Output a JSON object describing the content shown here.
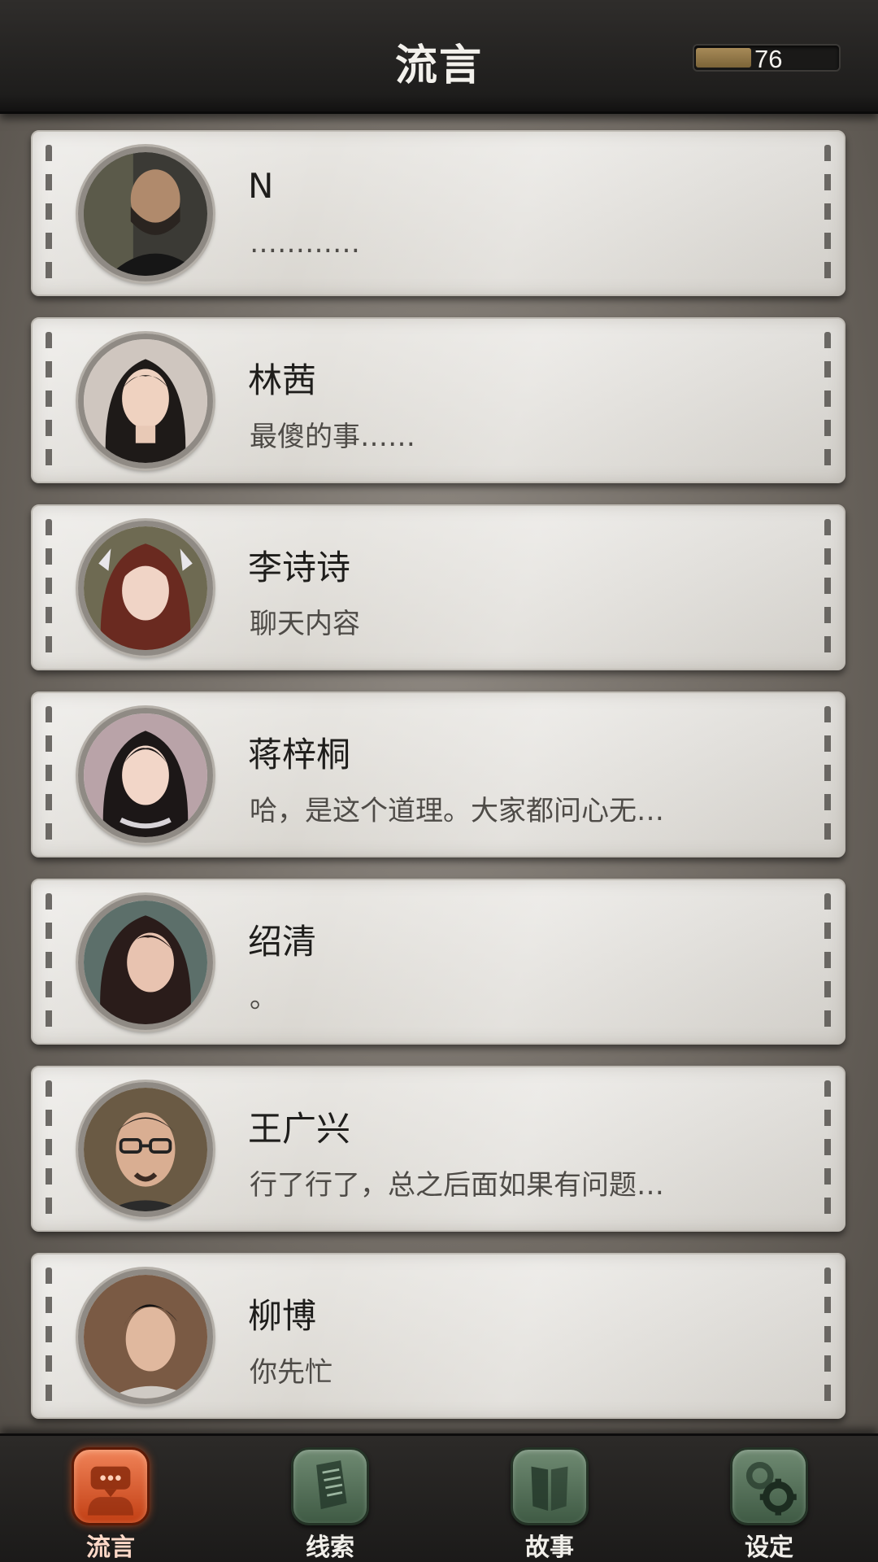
{
  "header": {
    "title": "流言",
    "energy": {
      "value_text": "76",
      "fill_fraction": 0.38
    }
  },
  "contacts": [
    {
      "name": "N",
      "message": "…………",
      "avatar": "man-bearded-portrait"
    },
    {
      "name": "林茜",
      "message": "最傻的事……",
      "avatar": "woman-long-dark-hair-portrait"
    },
    {
      "name": "李诗诗",
      "message": "聊天内容",
      "avatar": "woman-auburn-hair-portrait"
    },
    {
      "name": "蒋梓桐",
      "message": "哈，是这个道理。大家都问心无…",
      "avatar": "woman-dark-hair-portrait"
    },
    {
      "name": "绍清",
      "message": "。",
      "avatar": "woman-long-hair-portrait"
    },
    {
      "name": "王广兴",
      "message": "行了行了，总之后面如果有问题…",
      "avatar": "man-glasses-portrait"
    },
    {
      "name": "柳博",
      "message": "你先忙",
      "avatar": "man-short-hair-portrait"
    }
  ],
  "tabs": [
    {
      "label": "流言",
      "icon": "chat-bubble-icon",
      "active": true
    },
    {
      "label": "线索",
      "icon": "document-icon",
      "active": false
    },
    {
      "label": "故事",
      "icon": "book-icon",
      "active": false
    },
    {
      "label": "设定",
      "icon": "gear-icon",
      "active": false
    }
  ],
  "colors": {
    "header_bg": "#1e1d1c",
    "card_bg": "#e2dfda",
    "tab_active": "#d9532a",
    "tab_inactive": "#4e6b52"
  }
}
